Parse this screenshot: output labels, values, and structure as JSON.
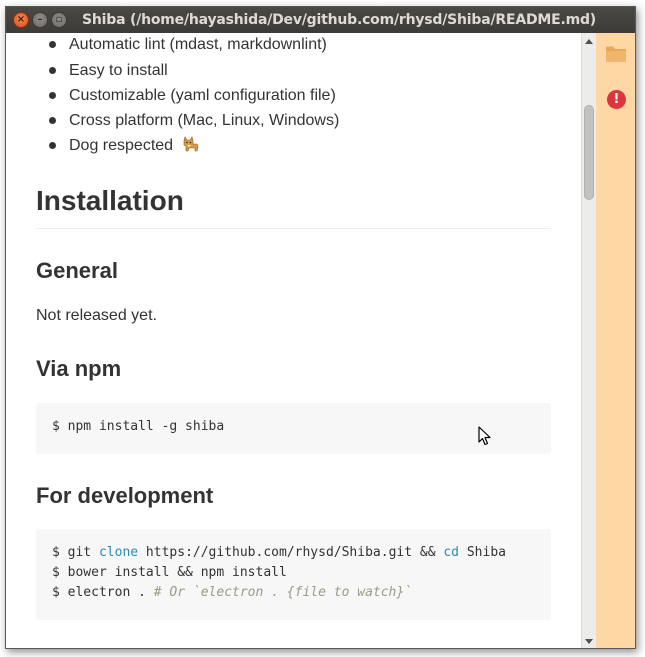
{
  "window": {
    "title": "Shiba (/home/hayashida/Dev/github.com/rhysd/Shiba/README.md)",
    "close_glyph": "×",
    "minimize_glyph": "–",
    "maximize_glyph": "▫"
  },
  "document": {
    "features": [
      "Automatic lint (mdast, markdownlint)",
      "Easy to install",
      "Customizable (yaml configuration file)",
      "Cross platform (Mac, Linux, Windows)",
      "Dog respected"
    ],
    "installation_heading": "Installation",
    "general_heading": "General",
    "general_text": "Not released yet.",
    "npm_heading": "Via npm",
    "npm_code": [
      "$ npm install -g shiba"
    ],
    "dev_heading": "For development",
    "dev_code": {
      "line1_prefix": "$ git ",
      "line1_kw1": "clone",
      "line1_mid": " https://github.com/rhysd/Shiba.git && ",
      "line1_kw2": "cd",
      "line1_suffix": " Shiba",
      "line2": "$ bower install && npm install",
      "line3_prefix": "$ electron . ",
      "line3_comment": "# Or `electron . {file to watch}`"
    }
  },
  "sidebar": {
    "icons": [
      "folder-icon",
      "alert-icon"
    ],
    "alert_glyph": "!",
    "background": "#ffd7a4"
  },
  "colors": {
    "code_keyword": "#2a8bb0",
    "code_comment": "#999988",
    "alert": "#d9363e"
  }
}
